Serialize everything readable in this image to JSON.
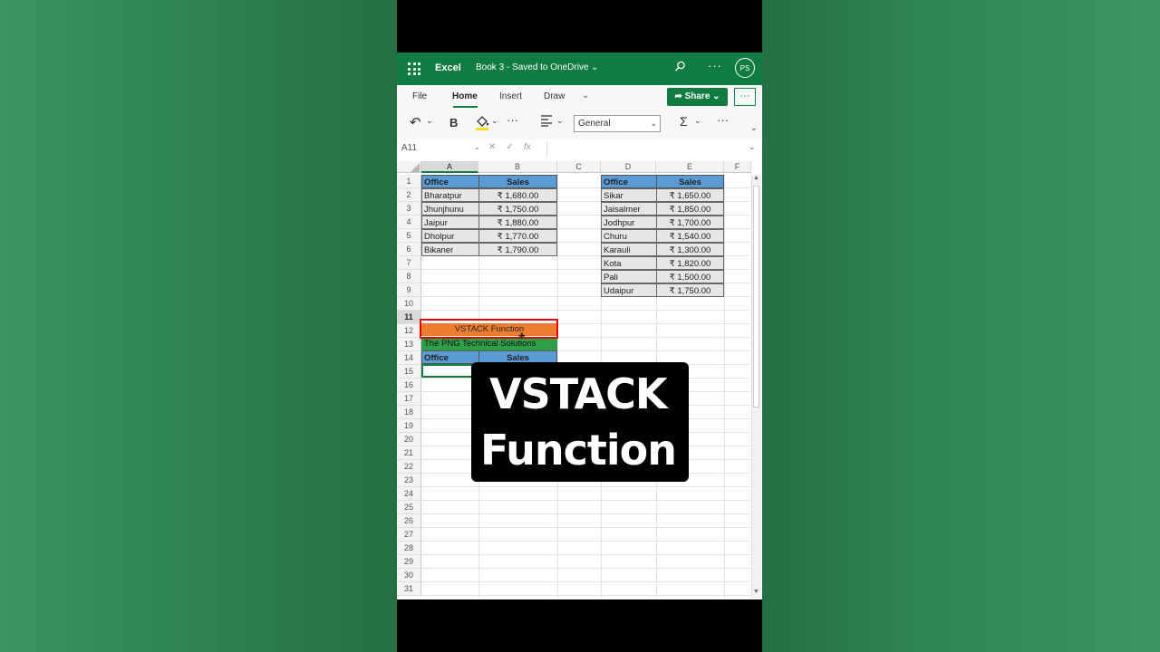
{
  "titlebar": {
    "app_name": "Excel",
    "doc_name": "Book 3  -  Saved to OneDrive ⌄",
    "avatar_initials": "PS"
  },
  "ribbon": {
    "tabs": [
      "File",
      "Home",
      "Insert",
      "Draw"
    ],
    "active_tab": "Home",
    "share_label": "Share ⌄",
    "number_format": "General"
  },
  "formula_bar": {
    "name_box": "A11",
    "fx": "fx",
    "content": ""
  },
  "columns": [
    "A",
    "B",
    "C",
    "D",
    "E",
    "F"
  ],
  "selected_column": "A",
  "rows": [
    "1",
    "2",
    "3",
    "4",
    "5",
    "6",
    "7",
    "8",
    "9",
    "10",
    "11",
    "12",
    "13",
    "14",
    "15",
    "16",
    "17",
    "18",
    "19",
    "20",
    "21",
    "22",
    "23",
    "24",
    "25",
    "26",
    "27",
    "28",
    "29",
    "30",
    "31"
  ],
  "selected_row": "11",
  "table1": {
    "headers": [
      "Office",
      "Sales"
    ],
    "rows": [
      [
        "Bharatpur",
        "₹ 1,680.00"
      ],
      [
        "Jhunjhunu",
        "₹ 1,750.00"
      ],
      [
        "Jaipur",
        "₹ 1,880.00"
      ],
      [
        "Dholpur",
        "₹ 1,770.00"
      ],
      [
        "Bikaner",
        "₹ 1,790.00"
      ]
    ]
  },
  "table2": {
    "headers": [
      "Office",
      "Sales"
    ],
    "rows": [
      [
        "Sikar",
        "₹ 1,650.00"
      ],
      [
        "Jaisalmer",
        "₹ 1,850.00"
      ],
      [
        "Jodhpur",
        "₹ 1,700.00"
      ],
      [
        "Churu",
        "₹ 1,540.00"
      ],
      [
        "Karauli",
        "₹ 1,300.00"
      ],
      [
        "Kota",
        "₹ 1,820.00"
      ],
      [
        "Pali",
        "₹ 1,500.00"
      ],
      [
        "Udaipur",
        "₹ 1,750.00"
      ]
    ]
  },
  "banner_title": "VSTACK Function",
  "banner_subtitle": "The PNG Technical Solutions",
  "result_headers": [
    "Office",
    "Sales"
  ],
  "overlay": {
    "line1": "VSTACK",
    "line2": "Function"
  },
  "colors": {
    "excel_green": "#107c41",
    "header_blue": "#5b9bd5",
    "banner_orange": "#ed7d31",
    "banner_green": "#2e9e48",
    "highlight_red": "#e00000"
  }
}
